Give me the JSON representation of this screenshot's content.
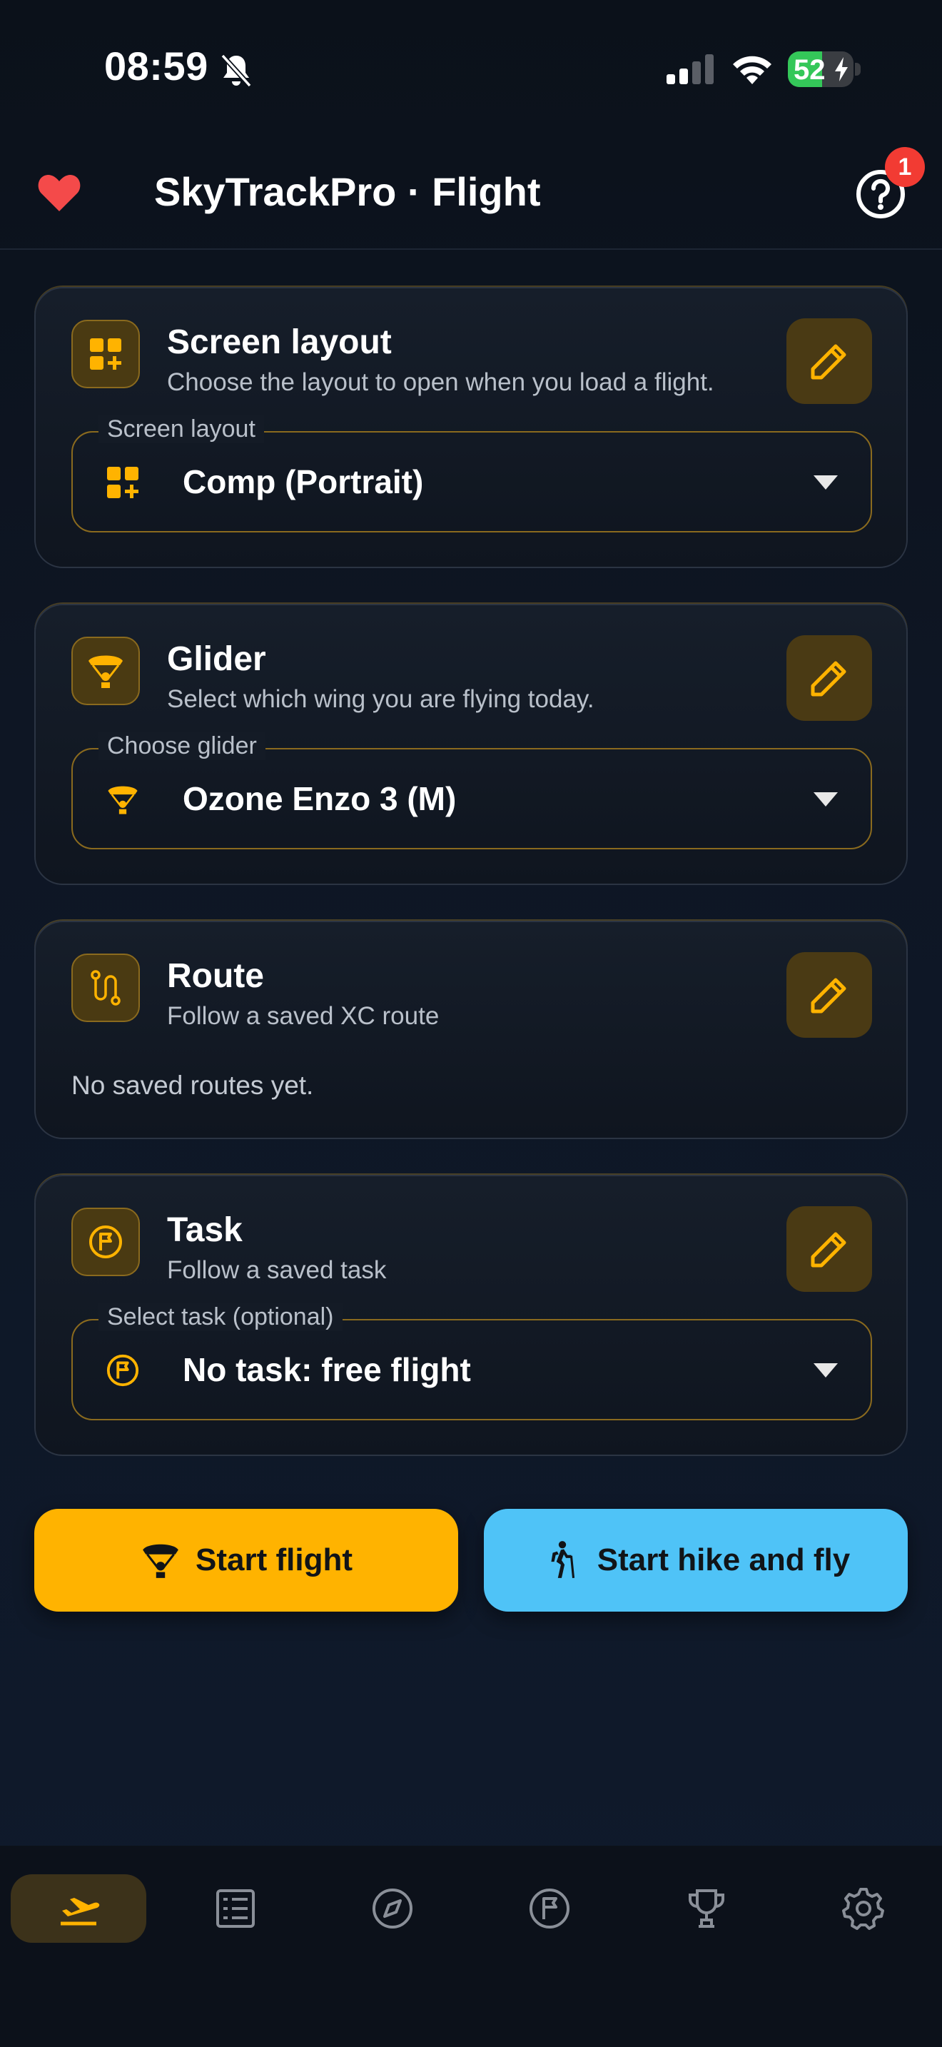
{
  "status": {
    "time": "08:59",
    "battery": "52",
    "battery_level_percent": 52,
    "icons": [
      "bell-muted-icon",
      "cellular-signal-icon",
      "wifi-icon",
      "battery-charging-icon"
    ]
  },
  "header": {
    "title": "SkyTrackPro · Flight",
    "notification_count": "1",
    "icons": [
      "heart-icon",
      "help-icon"
    ]
  },
  "cards": {
    "layout": {
      "title": "Screen layout",
      "subtitle": "Choose the layout to open when you load a flight.",
      "field_label": "Screen layout",
      "field_value": "Comp (Portrait)",
      "icon": "dashboard-add-icon"
    },
    "glider": {
      "title": "Glider",
      "subtitle": "Select which wing you are flying today.",
      "field_label": "Choose glider",
      "field_value": "Ozone Enzo 3 (M)",
      "icon": "paraglider-icon"
    },
    "route": {
      "title": "Route",
      "subtitle": "Follow a saved XC route",
      "empty": "No saved routes yet.",
      "icon": "route-icon"
    },
    "task": {
      "title": "Task",
      "subtitle": "Follow a saved task",
      "field_label": "Select task (optional)",
      "field_value": "No task: free flight",
      "icon": "flag-circle-icon"
    }
  },
  "actions": {
    "start_flight": "Start flight",
    "start_hike": "Start hike and fly"
  },
  "nav": {
    "items": [
      "flight-takeoff-icon",
      "logbook-icon",
      "compass-icon",
      "task-flag-icon",
      "trophy-icon",
      "settings-icon"
    ],
    "active": "flight-takeoff-icon"
  },
  "colors": {
    "accent": "#ffb300",
    "secondary": "#4fc3f7",
    "badge": "#f23b33",
    "heart": "#f44a4a",
    "battery": "#34c759"
  }
}
